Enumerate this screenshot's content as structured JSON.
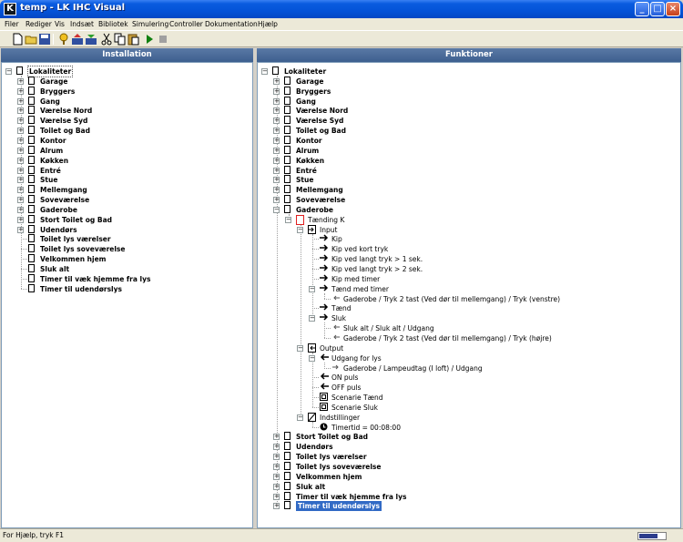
{
  "window": {
    "title": "temp - LK IHC Visual",
    "min": "_",
    "max": "□",
    "close": "×"
  },
  "menu": [
    "Filer",
    "Rediger",
    "Vis",
    "Indsæt",
    "Bibliotek",
    "Simulering",
    "Controller",
    "Dokumentation",
    "Hjælp"
  ],
  "toolbar": [
    "new",
    "open",
    "save",
    "help",
    "upload",
    "download",
    "cut",
    "copy",
    "paste",
    "run",
    "stop"
  ],
  "installation": {
    "header": "Installation",
    "items": [
      {
        "label": "Lokaliteter",
        "level": 0,
        "exp": "-",
        "bold": true,
        "icon": "doc",
        "outline": true
      },
      {
        "label": "Garage",
        "level": 1,
        "exp": "+",
        "bold": true,
        "icon": "doc"
      },
      {
        "label": "Bryggers",
        "level": 1,
        "exp": "+",
        "bold": true,
        "icon": "doc"
      },
      {
        "label": "Gang",
        "level": 1,
        "exp": "+",
        "bold": true,
        "icon": "doc"
      },
      {
        "label": "Værelse Nord",
        "level": 1,
        "exp": "+",
        "bold": true,
        "icon": "doc"
      },
      {
        "label": "Værelse Syd",
        "level": 1,
        "exp": "+",
        "bold": true,
        "icon": "doc"
      },
      {
        "label": "Toilet og Bad",
        "level": 1,
        "exp": "+",
        "bold": true,
        "icon": "doc"
      },
      {
        "label": "Kontor",
        "level": 1,
        "exp": "+",
        "bold": true,
        "icon": "doc"
      },
      {
        "label": "Alrum",
        "level": 1,
        "exp": "+",
        "bold": true,
        "icon": "doc"
      },
      {
        "label": "Køkken",
        "level": 1,
        "exp": "+",
        "bold": true,
        "icon": "doc"
      },
      {
        "label": "Entré",
        "level": 1,
        "exp": "+",
        "bold": true,
        "icon": "doc"
      },
      {
        "label": "Stue",
        "level": 1,
        "exp": "+",
        "bold": true,
        "icon": "doc"
      },
      {
        "label": "Mellemgang",
        "level": 1,
        "exp": "+",
        "bold": true,
        "icon": "doc"
      },
      {
        "label": "Soveværelse",
        "level": 1,
        "exp": "+",
        "bold": true,
        "icon": "doc"
      },
      {
        "label": "Gaderobe",
        "level": 1,
        "exp": "+",
        "bold": true,
        "icon": "doc"
      },
      {
        "label": "Stort Toilet og Bad",
        "level": 1,
        "exp": "+",
        "bold": true,
        "icon": "doc"
      },
      {
        "label": "Udendørs",
        "level": 1,
        "exp": "+",
        "bold": true,
        "icon": "doc"
      },
      {
        "label": "Toilet lys værelser",
        "level": 1,
        "exp": "",
        "bold": true,
        "icon": "doc"
      },
      {
        "label": "Toilet lys soveværelse",
        "level": 1,
        "exp": "",
        "bold": true,
        "icon": "doc"
      },
      {
        "label": "Velkommen hjem",
        "level": 1,
        "exp": "",
        "bold": true,
        "icon": "doc"
      },
      {
        "label": "Sluk alt",
        "level": 1,
        "exp": "",
        "bold": true,
        "icon": "doc"
      },
      {
        "label": "Timer til væk hjemme fra lys",
        "level": 1,
        "exp": "",
        "bold": true,
        "icon": "doc"
      },
      {
        "label": "Timer til udendørslys",
        "level": 1,
        "exp": "",
        "bold": true,
        "icon": "doc"
      }
    ]
  },
  "funktioner": {
    "header": "Funktioner",
    "items": [
      {
        "label": "Lokaliteter",
        "level": 0,
        "exp": "-",
        "bold": true,
        "icon": "doc"
      },
      {
        "label": "Garage",
        "level": 1,
        "exp": "+",
        "bold": true,
        "icon": "doc"
      },
      {
        "label": "Bryggers",
        "level": 1,
        "exp": "+",
        "bold": true,
        "icon": "doc"
      },
      {
        "label": "Gang",
        "level": 1,
        "exp": "+",
        "bold": true,
        "icon": "doc"
      },
      {
        "label": "Værelse Nord",
        "level": 1,
        "exp": "+",
        "bold": true,
        "icon": "doc"
      },
      {
        "label": "Værelse Syd",
        "level": 1,
        "exp": "+",
        "bold": true,
        "icon": "doc"
      },
      {
        "label": "Toilet og Bad",
        "level": 1,
        "exp": "+",
        "bold": true,
        "icon": "doc"
      },
      {
        "label": "Kontor",
        "level": 1,
        "exp": "+",
        "bold": true,
        "icon": "doc"
      },
      {
        "label": "Alrum",
        "level": 1,
        "exp": "+",
        "bold": true,
        "icon": "doc"
      },
      {
        "label": "Køkken",
        "level": 1,
        "exp": "+",
        "bold": true,
        "icon": "doc"
      },
      {
        "label": "Entré",
        "level": 1,
        "exp": "+",
        "bold": true,
        "icon": "doc"
      },
      {
        "label": "Stue",
        "level": 1,
        "exp": "+",
        "bold": true,
        "icon": "doc"
      },
      {
        "label": "Mellemgang",
        "level": 1,
        "exp": "+",
        "bold": true,
        "icon": "doc"
      },
      {
        "label": "Soveværelse",
        "level": 1,
        "exp": "+",
        "bold": true,
        "icon": "doc"
      },
      {
        "label": "Gaderobe",
        "level": 1,
        "exp": "-",
        "bold": true,
        "icon": "doc"
      },
      {
        "label": "Tænding K",
        "level": 2,
        "exp": "-",
        "bold": false,
        "icon": "redbox"
      },
      {
        "label": "Input",
        "level": 3,
        "exp": "-",
        "bold": false,
        "icon": "inbox"
      },
      {
        "label": "Kip",
        "level": 4,
        "exp": "",
        "bold": false,
        "icon": "arrow-right"
      },
      {
        "label": "Kip ved kort tryk",
        "level": 4,
        "exp": "",
        "bold": false,
        "icon": "arrow-right"
      },
      {
        "label": "Kip ved langt tryk > 1 sek.",
        "level": 4,
        "exp": "",
        "bold": false,
        "icon": "arrow-right"
      },
      {
        "label": "Kip ved langt tryk > 2 sek.",
        "level": 4,
        "exp": "",
        "bold": false,
        "icon": "arrow-right"
      },
      {
        "label": "Kip med timer",
        "level": 4,
        "exp": "",
        "bold": false,
        "icon": "arrow-right"
      },
      {
        "label": "Tænd med timer",
        "level": 4,
        "exp": "-",
        "bold": false,
        "icon": "arrow-right"
      },
      {
        "label": "Gaderobe / Tryk 2 tast (Ved dør til mellemgang)  / Tryk (venstre)",
        "level": 5,
        "exp": "",
        "bold": false,
        "icon": "link-left"
      },
      {
        "label": "Tænd",
        "level": 4,
        "exp": "",
        "bold": false,
        "icon": "arrow-right"
      },
      {
        "label": "Sluk",
        "level": 4,
        "exp": "-",
        "bold": false,
        "icon": "arrow-right"
      },
      {
        "label": "Sluk alt / Sluk alt / Udgang",
        "level": 5,
        "exp": "",
        "bold": false,
        "icon": "link-left"
      },
      {
        "label": "Gaderobe / Tryk 2 tast (Ved dør til mellemgang)  / Tryk (højre)",
        "level": 5,
        "exp": "",
        "bold": false,
        "icon": "link-left"
      },
      {
        "label": "Output",
        "level": 3,
        "exp": "-",
        "bold": false,
        "icon": "outbox"
      },
      {
        "label": "Udgang for lys",
        "level": 4,
        "exp": "-",
        "bold": false,
        "icon": "arrow-left"
      },
      {
        "label": "Gaderobe / Lampeudtag (I loft)  / Udgang",
        "level": 5,
        "exp": "",
        "bold": false,
        "icon": "link-right"
      },
      {
        "label": "ON puls",
        "level": 4,
        "exp": "",
        "bold": false,
        "icon": "arrow-left"
      },
      {
        "label": "OFF puls",
        "level": 4,
        "exp": "",
        "bold": false,
        "icon": "arrow-left"
      },
      {
        "label": "Scenarie Tænd",
        "level": 4,
        "exp": "",
        "bold": false,
        "icon": "scene"
      },
      {
        "label": "Scenarie Sluk",
        "level": 4,
        "exp": "",
        "bold": false,
        "icon": "scene"
      },
      {
        "label": "Indstillinger",
        "level": 3,
        "exp": "-",
        "bold": false,
        "icon": "settings"
      },
      {
        "label": "Timertid = 00:08:00",
        "level": 4,
        "exp": "",
        "bold": false,
        "icon": "clock"
      },
      {
        "label": "Stort Toilet og Bad",
        "level": 1,
        "exp": "+",
        "bold": true,
        "icon": "doc"
      },
      {
        "label": "Udendørs",
        "level": 1,
        "exp": "+",
        "bold": true,
        "icon": "doc"
      },
      {
        "label": "Toilet lys værelser",
        "level": 1,
        "exp": "+",
        "bold": true,
        "icon": "doc"
      },
      {
        "label": "Toilet lys soveværelse",
        "level": 1,
        "exp": "+",
        "bold": true,
        "icon": "doc"
      },
      {
        "label": "Velkommen hjem",
        "level": 1,
        "exp": "+",
        "bold": true,
        "icon": "doc"
      },
      {
        "label": "Sluk alt",
        "level": 1,
        "exp": "+",
        "bold": true,
        "icon": "doc"
      },
      {
        "label": "Timer til væk hjemme fra lys",
        "level": 1,
        "exp": "+",
        "bold": true,
        "icon": "doc"
      },
      {
        "label": "Timer til udendørslys",
        "level": 1,
        "exp": "+",
        "bold": true,
        "icon": "doc",
        "selected": true
      }
    ]
  },
  "status": {
    "text": "For Hjælp, tryk F1"
  }
}
